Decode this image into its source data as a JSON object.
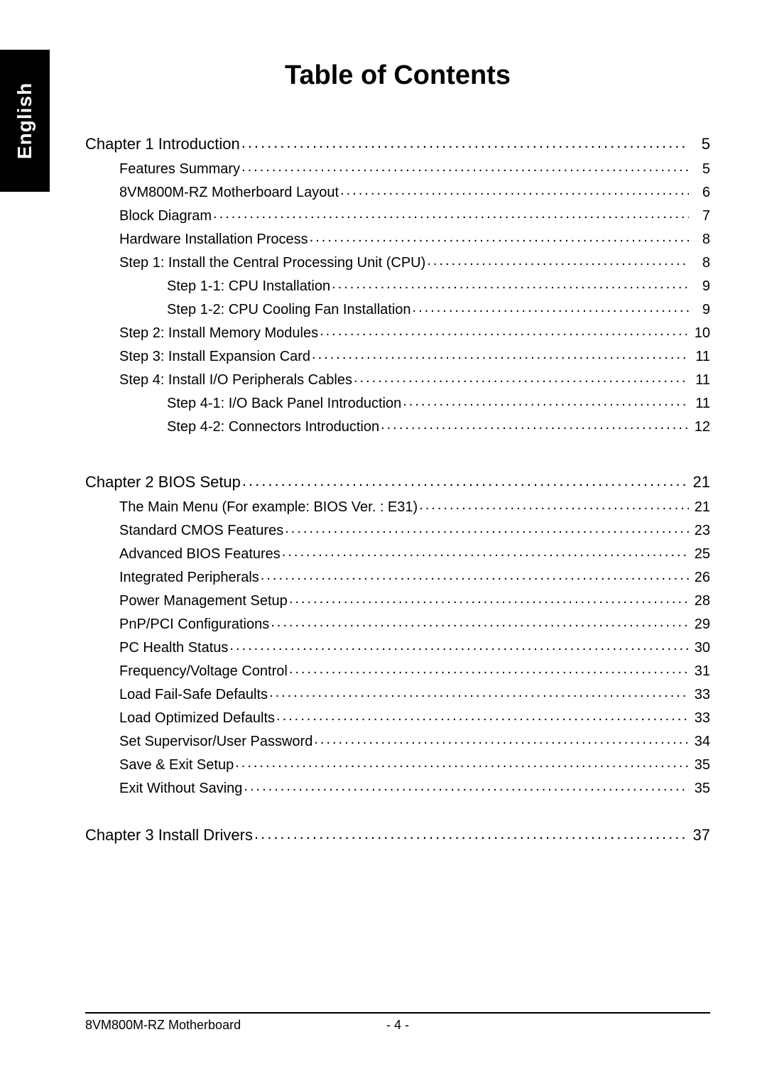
{
  "sidebar": {
    "language": "English"
  },
  "title": "Table of Contents",
  "toc": [
    {
      "level": 0,
      "title": "Chapter 1  Introduction",
      "page": "5"
    },
    {
      "level": 1,
      "title": "Features Summary",
      "page": "5"
    },
    {
      "level": 1,
      "title": "8VM800M-RZ Motherboard Layout",
      "page": "6"
    },
    {
      "level": 1,
      "title": "Block Diagram",
      "page": "7"
    },
    {
      "level": 1,
      "title": "Hardware Installation Process",
      "page": "8"
    },
    {
      "level": 1,
      "title": "Step 1: Install the Central Processing Unit (CPU)",
      "page": "8"
    },
    {
      "level": 2,
      "title": "Step 1-1: CPU Installation",
      "page": "9"
    },
    {
      "level": 2,
      "title": "Step 1-2: CPU Cooling Fan Installation",
      "page": "9"
    },
    {
      "level": 1,
      "title": "Step 2: Install Memory Modules",
      "page": "10"
    },
    {
      "level": 1,
      "title": "Step 3: Install Expansion Card",
      "page": "11"
    },
    {
      "level": 1,
      "title": "Step 4: Install I/O Peripherals Cables",
      "page": "11"
    },
    {
      "level": 2,
      "title": "Step 4-1: I/O Back Panel Introduction",
      "page": "11"
    },
    {
      "level": 2,
      "title": "Step 4-2: Connectors Introduction",
      "page": "12"
    },
    {
      "level": -1,
      "title": "",
      "page": ""
    },
    {
      "level": 0,
      "title": "Chapter 2  BIOS Setup",
      "page": "21"
    },
    {
      "level": 1,
      "title": "The Main Menu (For example: BIOS Ver. : E31)",
      "page": "21"
    },
    {
      "level": 1,
      "title": "Standard CMOS Features",
      "page": "23"
    },
    {
      "level": 1,
      "title": "Advanced BIOS Features",
      "page": "25"
    },
    {
      "level": 1,
      "title": "Integrated Peripherals",
      "page": "26"
    },
    {
      "level": 1,
      "title": "Power Management Setup",
      "page": "28"
    },
    {
      "level": 1,
      "title": "PnP/PCI Configurations",
      "page": "29"
    },
    {
      "level": 1,
      "title": "PC Health Status",
      "page": "30"
    },
    {
      "level": 1,
      "title": "Frequency/Voltage Control",
      "page": "31"
    },
    {
      "level": 1,
      "title": "Load Fail-Safe Defaults",
      "page": "33"
    },
    {
      "level": 1,
      "title": "Load Optimized Defaults",
      "page": "33"
    },
    {
      "level": 1,
      "title": "Set Supervisor/User Password",
      "page": "34"
    },
    {
      "level": 1,
      "title": "Save & Exit Setup",
      "page": "35"
    },
    {
      "level": 1,
      "title": "Exit Without Saving",
      "page": "35"
    },
    {
      "level": -2,
      "title": "",
      "page": ""
    },
    {
      "level": 0,
      "title": "Chapter 3  Install Drivers",
      "page": "37"
    }
  ],
  "footer": {
    "left": "8VM800M-RZ Motherboard",
    "center": "- 4 -"
  }
}
